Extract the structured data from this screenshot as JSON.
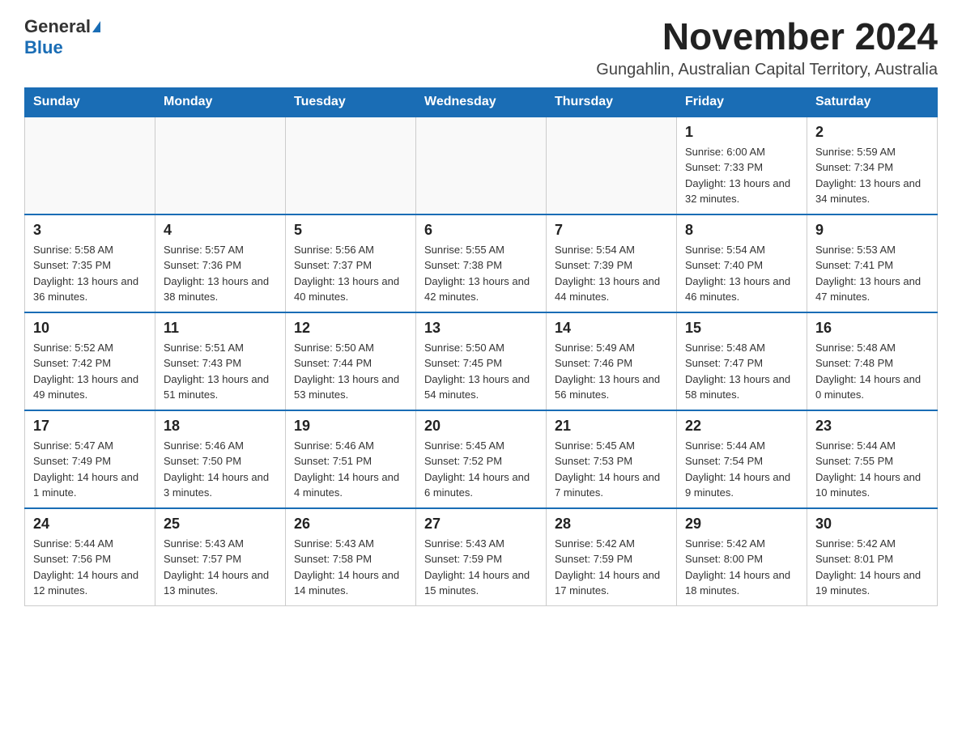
{
  "header": {
    "logo_general": "General",
    "logo_blue": "Blue",
    "month_title": "November 2024",
    "location": "Gungahlin, Australian Capital Territory, Australia"
  },
  "days_of_week": [
    "Sunday",
    "Monday",
    "Tuesday",
    "Wednesday",
    "Thursday",
    "Friday",
    "Saturday"
  ],
  "weeks": [
    {
      "days": [
        {
          "num": "",
          "info": ""
        },
        {
          "num": "",
          "info": ""
        },
        {
          "num": "",
          "info": ""
        },
        {
          "num": "",
          "info": ""
        },
        {
          "num": "",
          "info": ""
        },
        {
          "num": "1",
          "info": "Sunrise: 6:00 AM\nSunset: 7:33 PM\nDaylight: 13 hours and 32 minutes."
        },
        {
          "num": "2",
          "info": "Sunrise: 5:59 AM\nSunset: 7:34 PM\nDaylight: 13 hours and 34 minutes."
        }
      ]
    },
    {
      "days": [
        {
          "num": "3",
          "info": "Sunrise: 5:58 AM\nSunset: 7:35 PM\nDaylight: 13 hours and 36 minutes."
        },
        {
          "num": "4",
          "info": "Sunrise: 5:57 AM\nSunset: 7:36 PM\nDaylight: 13 hours and 38 minutes."
        },
        {
          "num": "5",
          "info": "Sunrise: 5:56 AM\nSunset: 7:37 PM\nDaylight: 13 hours and 40 minutes."
        },
        {
          "num": "6",
          "info": "Sunrise: 5:55 AM\nSunset: 7:38 PM\nDaylight: 13 hours and 42 minutes."
        },
        {
          "num": "7",
          "info": "Sunrise: 5:54 AM\nSunset: 7:39 PM\nDaylight: 13 hours and 44 minutes."
        },
        {
          "num": "8",
          "info": "Sunrise: 5:54 AM\nSunset: 7:40 PM\nDaylight: 13 hours and 46 minutes."
        },
        {
          "num": "9",
          "info": "Sunrise: 5:53 AM\nSunset: 7:41 PM\nDaylight: 13 hours and 47 minutes."
        }
      ]
    },
    {
      "days": [
        {
          "num": "10",
          "info": "Sunrise: 5:52 AM\nSunset: 7:42 PM\nDaylight: 13 hours and 49 minutes."
        },
        {
          "num": "11",
          "info": "Sunrise: 5:51 AM\nSunset: 7:43 PM\nDaylight: 13 hours and 51 minutes."
        },
        {
          "num": "12",
          "info": "Sunrise: 5:50 AM\nSunset: 7:44 PM\nDaylight: 13 hours and 53 minutes."
        },
        {
          "num": "13",
          "info": "Sunrise: 5:50 AM\nSunset: 7:45 PM\nDaylight: 13 hours and 54 minutes."
        },
        {
          "num": "14",
          "info": "Sunrise: 5:49 AM\nSunset: 7:46 PM\nDaylight: 13 hours and 56 minutes."
        },
        {
          "num": "15",
          "info": "Sunrise: 5:48 AM\nSunset: 7:47 PM\nDaylight: 13 hours and 58 minutes."
        },
        {
          "num": "16",
          "info": "Sunrise: 5:48 AM\nSunset: 7:48 PM\nDaylight: 14 hours and 0 minutes."
        }
      ]
    },
    {
      "days": [
        {
          "num": "17",
          "info": "Sunrise: 5:47 AM\nSunset: 7:49 PM\nDaylight: 14 hours and 1 minute."
        },
        {
          "num": "18",
          "info": "Sunrise: 5:46 AM\nSunset: 7:50 PM\nDaylight: 14 hours and 3 minutes."
        },
        {
          "num": "19",
          "info": "Sunrise: 5:46 AM\nSunset: 7:51 PM\nDaylight: 14 hours and 4 minutes."
        },
        {
          "num": "20",
          "info": "Sunrise: 5:45 AM\nSunset: 7:52 PM\nDaylight: 14 hours and 6 minutes."
        },
        {
          "num": "21",
          "info": "Sunrise: 5:45 AM\nSunset: 7:53 PM\nDaylight: 14 hours and 7 minutes."
        },
        {
          "num": "22",
          "info": "Sunrise: 5:44 AM\nSunset: 7:54 PM\nDaylight: 14 hours and 9 minutes."
        },
        {
          "num": "23",
          "info": "Sunrise: 5:44 AM\nSunset: 7:55 PM\nDaylight: 14 hours and 10 minutes."
        }
      ]
    },
    {
      "days": [
        {
          "num": "24",
          "info": "Sunrise: 5:44 AM\nSunset: 7:56 PM\nDaylight: 14 hours and 12 minutes."
        },
        {
          "num": "25",
          "info": "Sunrise: 5:43 AM\nSunset: 7:57 PM\nDaylight: 14 hours and 13 minutes."
        },
        {
          "num": "26",
          "info": "Sunrise: 5:43 AM\nSunset: 7:58 PM\nDaylight: 14 hours and 14 minutes."
        },
        {
          "num": "27",
          "info": "Sunrise: 5:43 AM\nSunset: 7:59 PM\nDaylight: 14 hours and 15 minutes."
        },
        {
          "num": "28",
          "info": "Sunrise: 5:42 AM\nSunset: 7:59 PM\nDaylight: 14 hours and 17 minutes."
        },
        {
          "num": "29",
          "info": "Sunrise: 5:42 AM\nSunset: 8:00 PM\nDaylight: 14 hours and 18 minutes."
        },
        {
          "num": "30",
          "info": "Sunrise: 5:42 AM\nSunset: 8:01 PM\nDaylight: 14 hours and 19 minutes."
        }
      ]
    }
  ]
}
